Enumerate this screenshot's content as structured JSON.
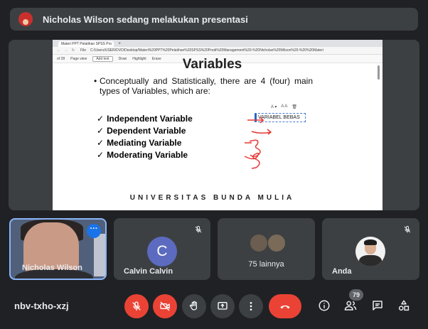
{
  "banner": {
    "text": "Nicholas Wilson sedang melakukan presentasi"
  },
  "browser": {
    "tab_title": "Materi PPT Pelatihan SPSS Pro",
    "tab_new": "+",
    "address_nav": "← → ↻",
    "address_prefix": "File",
    "address_url": "C:/Users/USER/DVD/Desktop/Materi%20PPT%20Pelatihan%20SPSS%20Prodi%20Management%20-%20Nicholas%20Wilson%20-%20%20Materi",
    "pdf_page": "of 28",
    "pdf_pageview": "Page view",
    "pdf_addtext": "Add text",
    "pdf_draw": "Draw",
    "pdf_highlight": "Highlight",
    "pdf_erase": "Erase"
  },
  "slide": {
    "title": "Variables",
    "intro": "Conceptually and Statistically, there are 4 (four) main types of Variables, which are:",
    "variables": [
      "Independent Variable",
      "Dependent Variable",
      "Mediating Variable",
      "Moderating Variable"
    ],
    "textbox": "VARIABEL BEBAS",
    "footer": "UNIVERSITAS BUNDA MULIA"
  },
  "tiles": {
    "presenter": {
      "name": "Nicholas Wilson"
    },
    "calvin": {
      "initial": "C",
      "name": "Calvin Calvin"
    },
    "others": {
      "label": "75 lainnya"
    },
    "self": {
      "name": "Anda"
    }
  },
  "controls": {
    "meeting_code": "nbv-txho-xzj",
    "participant_count": "79"
  },
  "colors": {
    "background": "#202124",
    "surface": "#3c4043",
    "danger": "#ea4335",
    "accent": "#1a73e8",
    "avatar": "#5c6bc0"
  }
}
